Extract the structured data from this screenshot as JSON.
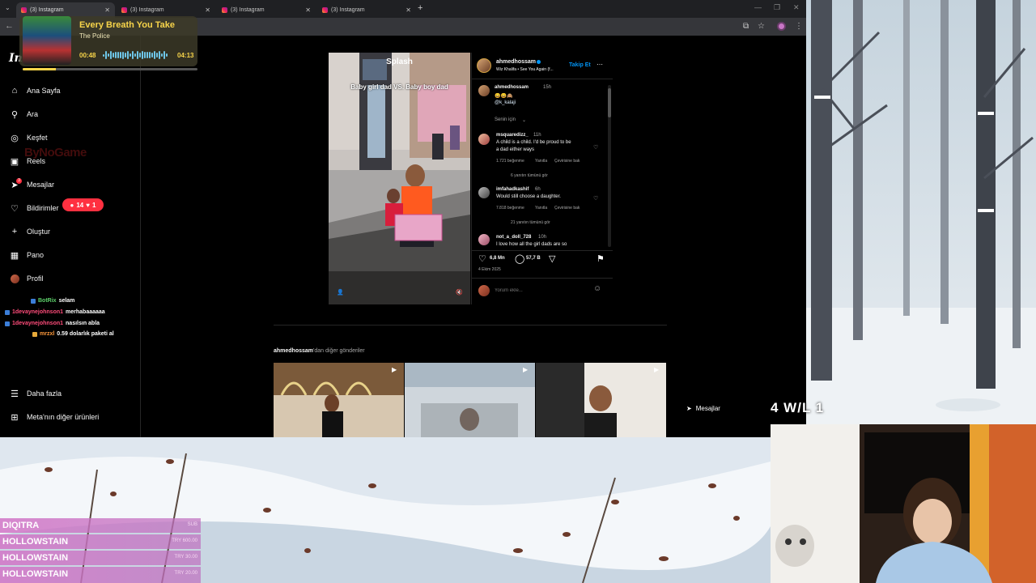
{
  "browser": {
    "tabs": [
      {
        "label": "(3) Instagram",
        "active": true
      },
      {
        "label": "(3) Instagram",
        "active": false
      },
      {
        "label": "(3) Instagram",
        "active": false
      },
      {
        "label": "(3) Instagram",
        "active": false
      }
    ],
    "new_tab": "+"
  },
  "sidebar": {
    "logo": "Ins",
    "items": [
      {
        "label": "Ana Sayfa",
        "icon": "home-icon"
      },
      {
        "label": "Ara",
        "icon": "search-icon"
      },
      {
        "label": "Keşfet",
        "icon": "compass-icon"
      },
      {
        "label": "Reels",
        "icon": "reels-icon"
      },
      {
        "label": "Mesajlar",
        "icon": "messenger-icon"
      },
      {
        "label": "Bildirimler",
        "icon": "heart-icon"
      },
      {
        "label": "Oluştur",
        "icon": "plus-icon"
      },
      {
        "label": "Pano",
        "icon": "dashboard-icon"
      },
      {
        "label": "Profil",
        "icon": "avatar"
      }
    ],
    "notif_badge": {
      "comments": "14",
      "likes": "1"
    },
    "msg_badge": "3",
    "bottom": [
      {
        "label": "Daha fazla",
        "icon": "menu-icon"
      },
      {
        "label": "Meta'nın diğer ürünleri",
        "icon": "meta-icon"
      }
    ],
    "watermark": "ByNoGame"
  },
  "chat": [
    {
      "user": "BotRix",
      "message": "selam"
    },
    {
      "user": "1devaynejohnson1",
      "message": "merhabaaaaaa"
    },
    {
      "user": "1devaynejohnson1",
      "message": "nasılsın abla"
    },
    {
      "user": "mrzxl",
      "message": "0.59 dolarlık paketi al"
    }
  ],
  "song": {
    "title": "Every Breath You Take",
    "artist": "The Police",
    "current": "00:48",
    "total": "04:13",
    "progress": 0.19
  },
  "post": {
    "overlay_text": "Baby girl dad VS. Baby boy dad",
    "store_sign": "Splash",
    "author": "ahmedhossam",
    "song": "Wiz Khalifa • See You Again (f...",
    "follow": "Takip Et",
    "caption_time": "15h",
    "caption_emoji": "😄😄🙈",
    "caption_mention": "@k_kalaji",
    "sort": "Senin için",
    "comments": [
      {
        "user": "msquaredizz_",
        "time": "11h",
        "text1": "A child is a child. I'd be proud to be",
        "text2": "a dad either ways",
        "likes": "1.721 beğenme",
        "reply": "Yanıtla",
        "translate": "Çevirisine bak",
        "more": "6 yanıtın tümünü gör"
      },
      {
        "user": "imfahadkashif",
        "time": "6h",
        "text1": "Would still choose a daughter.",
        "text2": "",
        "likes": "7.818 beğenme",
        "reply": "Yanıtla",
        "translate": "Çevirisine bak",
        "more": "21 yanıtın tümünü gör"
      },
      {
        "user": "not_a_doll_728",
        "time": "10h",
        "text1": "I love how all the girl dads are so",
        "text2": "",
        "likes": "",
        "reply": "",
        "translate": "",
        "more": ""
      }
    ],
    "like_count": "6,8 Mn",
    "comment_count": "57,7 B",
    "date": "4 Ekim 2025",
    "comment_placeholder": "Yorum ekle..."
  },
  "more_posts_user": "ahmedhossam",
  "more_posts_suffix": "'dan diğer gönderiler",
  "overlay": {
    "messages_label": "Mesajlar",
    "win_loss": "4 W/L 1"
  },
  "subs": [
    {
      "name": "DIQITRA",
      "amount": "SUB"
    },
    {
      "name": "HOLLOWSTAIN",
      "amount": "TRY 600.00"
    },
    {
      "name": "HOLLOWSTAIN",
      "amount": "TRY 30.00"
    },
    {
      "name": "HOLLOWSTAIN",
      "amount": "TRY 20.00"
    }
  ],
  "colors": {
    "accent": "#0095f6",
    "badge": "#ff3040",
    "song_title": "#f7d44a",
    "sub_bg": "#d278c8"
  }
}
